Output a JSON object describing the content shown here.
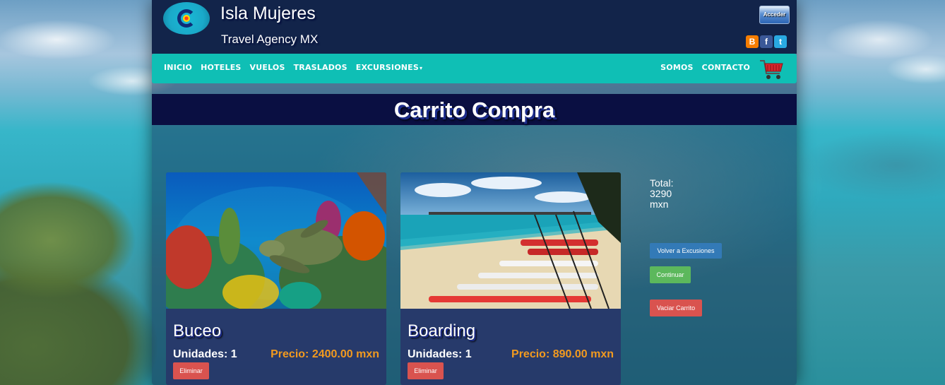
{
  "brand": {
    "title": "Isla Mujeres",
    "subtitle": "Travel Agency MX",
    "login_label": "Acceder",
    "social": [
      {
        "name": "blogger-icon",
        "glyph": "B"
      },
      {
        "name": "facebook-icon",
        "glyph": "f"
      },
      {
        "name": "twitter-icon",
        "glyph": "t"
      }
    ]
  },
  "nav": {
    "left": [
      {
        "label": "INICIO",
        "name": "nav-item-inicio"
      },
      {
        "label": "HOTELES",
        "name": "nav-item-hoteles"
      },
      {
        "label": "VUELOS",
        "name": "nav-item-vuelos"
      },
      {
        "label": "TRASLADOS",
        "name": "nav-item-traslados"
      },
      {
        "label": "EXCURSIONES",
        "name": "nav-item-excursiones",
        "dropdown": true
      }
    ],
    "right": [
      {
        "label": "SOMOS",
        "name": "nav-item-somos"
      },
      {
        "label": "CONTACTO",
        "name": "nav-item-contacto"
      }
    ],
    "cart_icon": "shopping-cart-icon"
  },
  "page": {
    "title": "Carrito Compra"
  },
  "cart": {
    "items": [
      {
        "name": "Buceo",
        "units_label": "Unidades: 1",
        "price_label": "Precio: 2400.00 mxn",
        "remove_label": "Eliminar",
        "image": "underwater-turtle-reef"
      },
      {
        "name": "Boarding",
        "units_label": "Unidades: 1",
        "price_label": "Precio: 890.00 mxn",
        "remove_label": "Eliminar",
        "image": "beach-paddleboards"
      }
    ],
    "summary": {
      "total_label": "Total:",
      "total_value": "3290",
      "currency": "mxn",
      "back_label": "Volver a Excusiones",
      "continue_label": "Continuar",
      "empty_label": "Vaciar Carrito"
    }
  },
  "colors": {
    "header_bg": "#12244a",
    "navbar_bg": "#0fbfb5",
    "title_band": "#0a0f42",
    "price": "#f29a1f",
    "danger": "#d9534f",
    "primary": "#337ab7",
    "success": "#5cb85c"
  }
}
